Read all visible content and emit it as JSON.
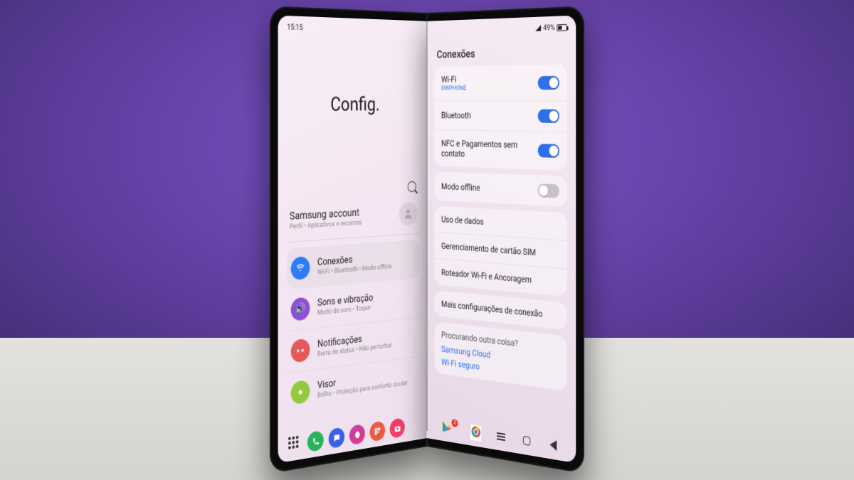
{
  "status": {
    "time": "15:15",
    "battery_pct": "49%"
  },
  "left": {
    "title": "Config.",
    "account": {
      "title": "Samsung account",
      "subtitle": "Perfil • Aplicativos e recursos"
    },
    "categories": [
      {
        "title": "Conexões",
        "subtitle": "Wi-Fi • Bluetooth • Modo offline"
      },
      {
        "title": "Sons e vibração",
        "subtitle": "Modo de som • Toque"
      },
      {
        "title": "Notificações",
        "subtitle": "Barra de status • Não perturbar"
      },
      {
        "title": "Visor",
        "subtitle": "Brilho • Proteção para conforto ocular"
      }
    ]
  },
  "right": {
    "title": "Conexões",
    "toggles": [
      {
        "label": "Wi-Fi",
        "sub": "DWPHONE",
        "on": true
      },
      {
        "label": "Bluetooth",
        "on": true
      },
      {
        "label": "NFC e Pagamentos sem contato",
        "on": true
      }
    ],
    "offline": {
      "label": "Modo offline",
      "on": false
    },
    "links": [
      "Uso de dados",
      "Gerenciamento de cartão SIM",
      "Roteador Wi-Fi e Ancoragem"
    ],
    "more": "Mais configurações de conexão",
    "footer": {
      "question": "Procurando outra coisa?",
      "link1": "Samsung Cloud",
      "link2": "Wi-Fi seguro"
    }
  },
  "dock_badge": "2"
}
